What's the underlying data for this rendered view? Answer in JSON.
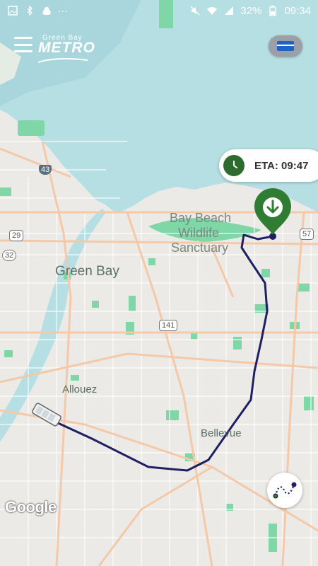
{
  "status_bar": {
    "left_icons": [
      "image-icon",
      "bluetooth-icon",
      "drive-icon",
      "more-icon"
    ],
    "more_dots": "···",
    "battery": "32%",
    "time": "09:34",
    "right_icons": [
      "mute-icon",
      "wifi-icon",
      "signal-icon",
      "battery-icon"
    ]
  },
  "header": {
    "logo_small": "Green Bay",
    "logo_big": "METRO"
  },
  "eta": {
    "label": "ETA: 09:47"
  },
  "map": {
    "labels": {
      "bay_beach_1": "Bay Beach",
      "bay_beach_2": "Wildlife",
      "bay_beach_3": "Sanctuary",
      "green_bay": "Green Bay",
      "allouez": "Allouez",
      "bellevue": "Bellevue"
    },
    "shields": {
      "s43": "43",
      "s29": "29",
      "s32": "32",
      "s57": "57",
      "s141": "141"
    },
    "attribution": "Google",
    "colors": {
      "water": "#b6dfe3",
      "land": "#eceae7",
      "park": "#7fd6a6",
      "major_road": "#f5c9a8",
      "route": "#1f1f63",
      "marker": "#2e7d32"
    }
  }
}
